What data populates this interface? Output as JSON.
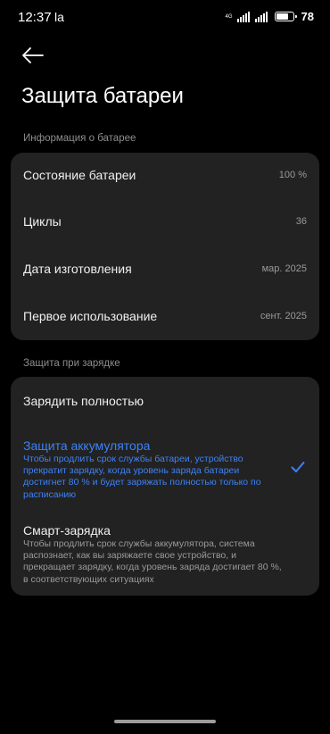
{
  "status_bar": {
    "time": "12:37",
    "app_indicator": "la",
    "network": "4G",
    "battery_percent": "78",
    "battery_level": 0.78
  },
  "header": {
    "back_icon": "arrow-left-icon",
    "title": "Защита батареи"
  },
  "battery_info": {
    "section_label": "Информация о батарее",
    "rows": [
      {
        "label": "Состояние батареи",
        "value": "100 %"
      },
      {
        "label": "Циклы",
        "value": "36"
      },
      {
        "label": "Дата изготовления",
        "value": "мар. 2025"
      },
      {
        "label": "Первое использование",
        "value": "сент. 2025"
      }
    ]
  },
  "charging_protection": {
    "section_label": "Защита при зарядке",
    "options": [
      {
        "title": "Зарядить полностью",
        "description": "",
        "selected": false
      },
      {
        "title": "Защита аккумулятора",
        "description": "Чтобы продлить срок службы батареи, устройство прекратит зарядку, когда уровень заряда батареи достигнет 80 % и будет заряжать полностью только по расписанию",
        "selected": true
      },
      {
        "title": "Смарт-зарядка",
        "description": "Чтобы продлить срок службы аккумулятора, система распознает, как вы заряжаете свое устройство, и прекращает зарядку, когда уровень заряда достигает 80 %, в соответствующих ситуациях",
        "selected": false
      }
    ],
    "check_icon": "checkmark-icon"
  },
  "colors": {
    "background": "#000000",
    "card": "#222222",
    "accent": "#3d82f6",
    "secondary_text": "#9a9a9a"
  }
}
